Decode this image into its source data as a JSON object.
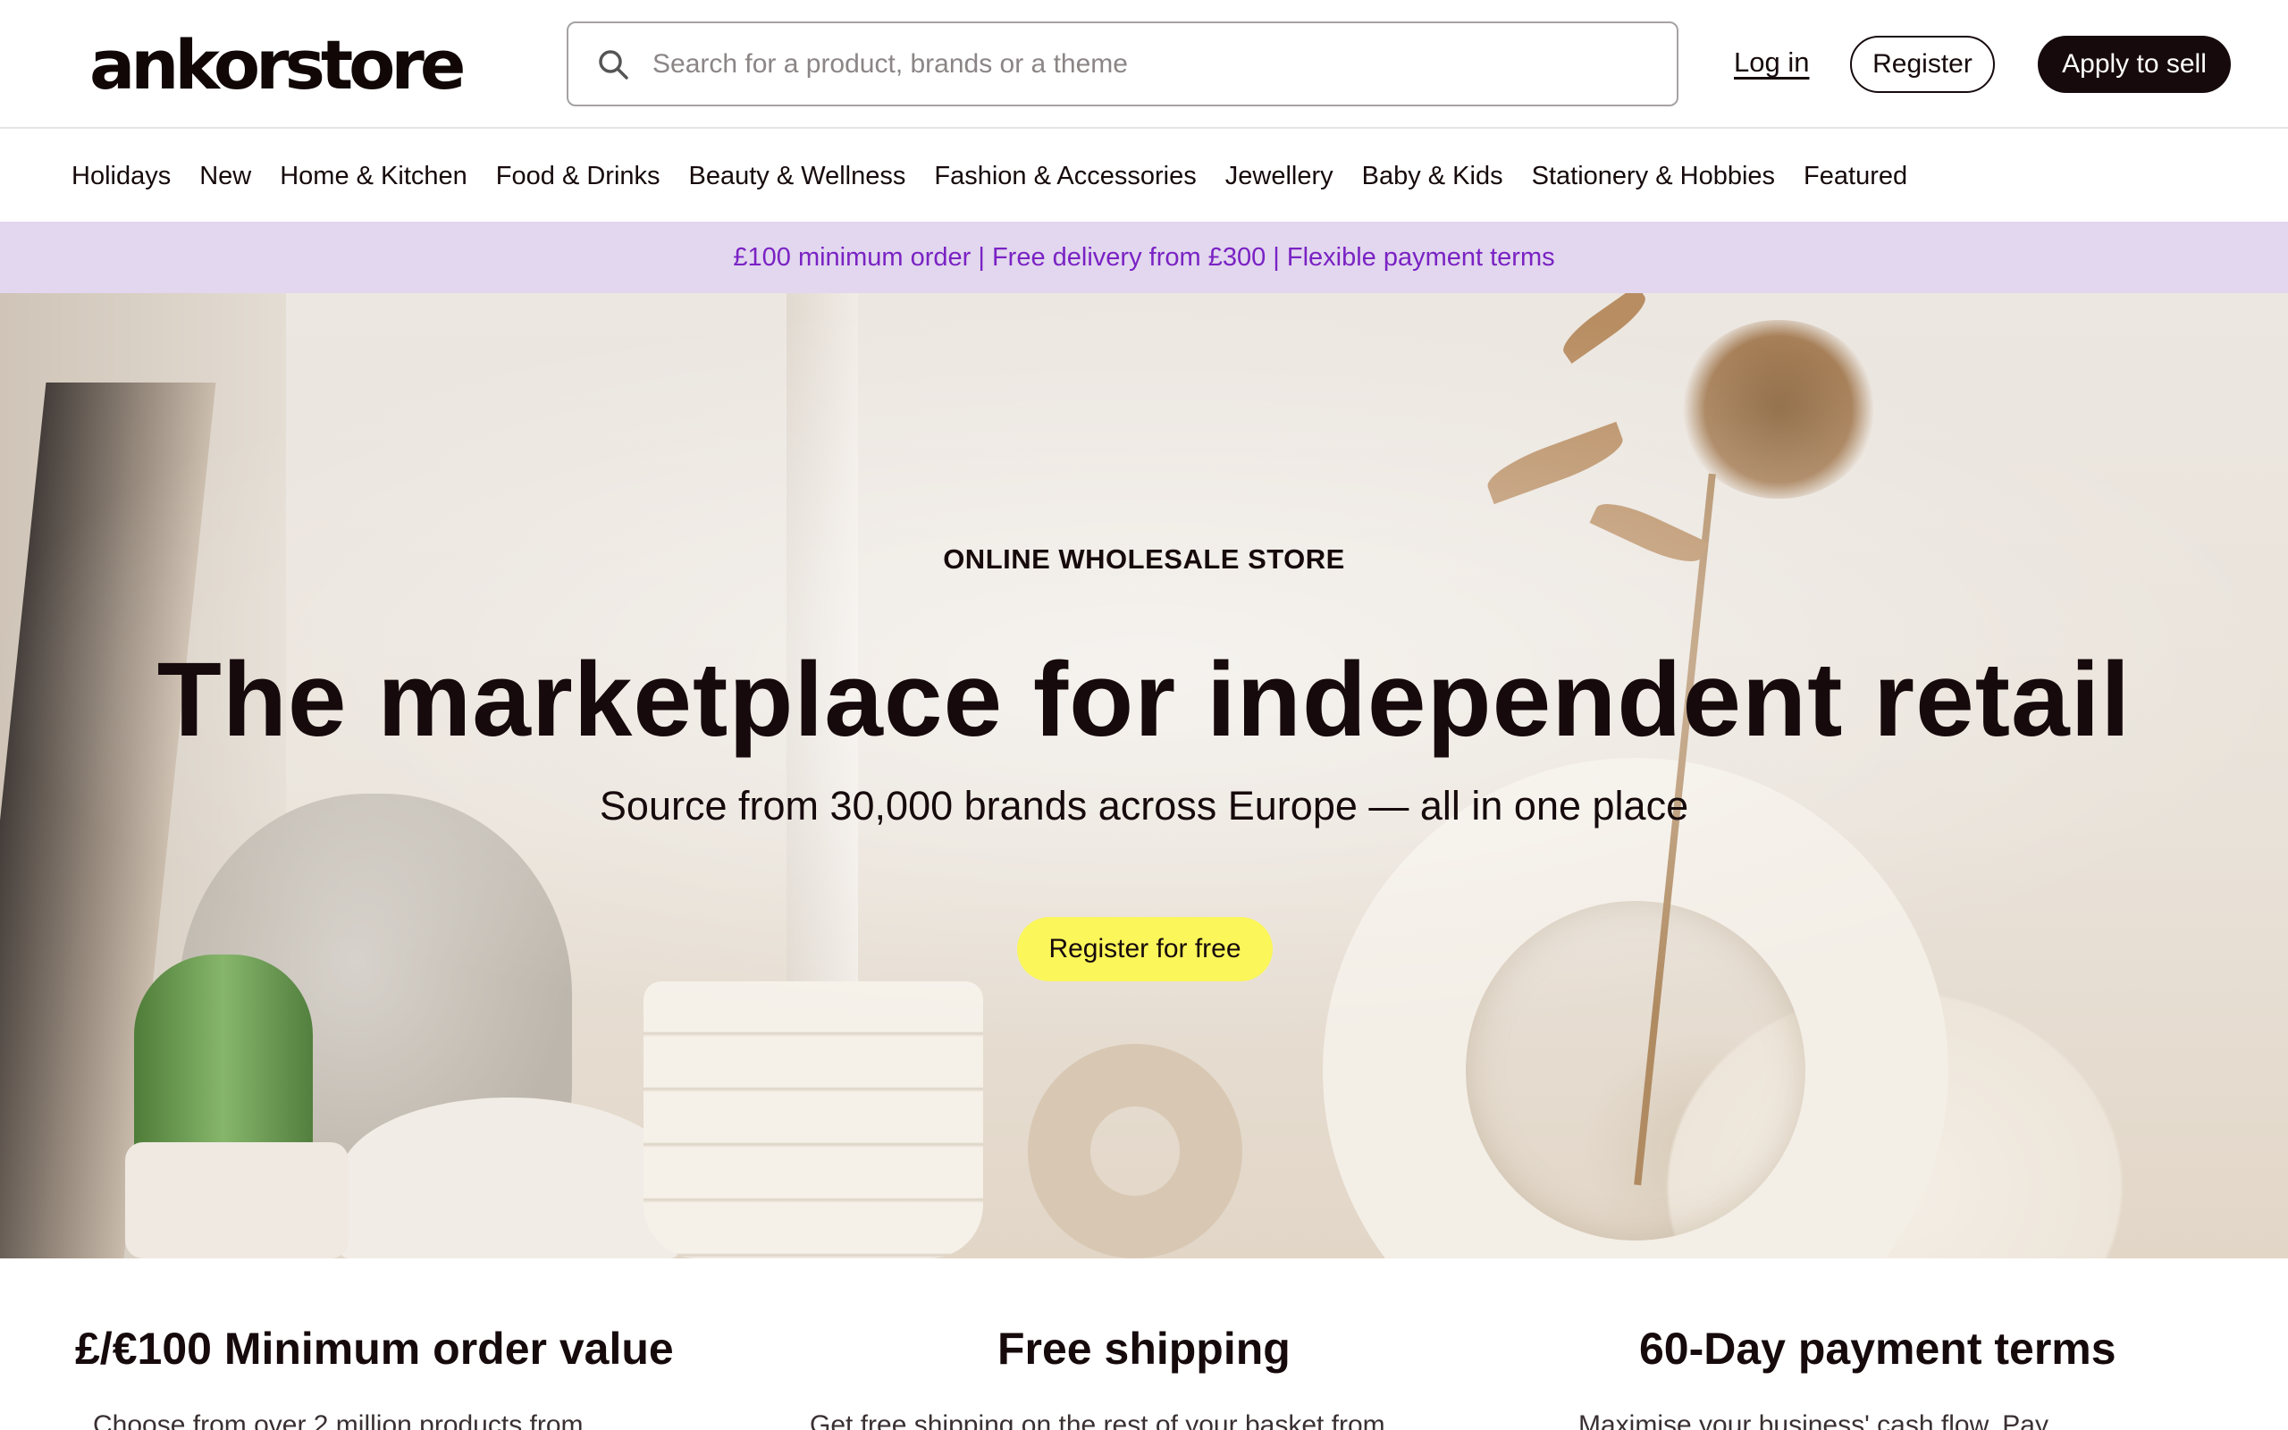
{
  "header": {
    "logo": "ankorstore",
    "search_placeholder": "Search for a product, brands or a theme",
    "login_label": "Log in",
    "register_label": "Register",
    "apply_label": "Apply to sell"
  },
  "nav": {
    "items": [
      "Holidays",
      "New",
      "Home & Kitchen",
      "Food & Drinks",
      "Beauty & Wellness",
      "Fashion & Accessories",
      "Jewellery",
      "Baby & Kids",
      "Stationery & Hobbies",
      "Featured"
    ]
  },
  "promo": {
    "text": "£100 minimum order | Free delivery from £300 | Flexible payment terms"
  },
  "hero": {
    "kicker": "ONLINE WHOLESALE STORE",
    "title": "The marketplace for independent retail",
    "subtitle": "Source from 30,000 brands across Europe — all in one place",
    "cta_label": "Register for free"
  },
  "value_props": [
    {
      "title": "£/€100 Minimum order value",
      "desc": "Choose from over 2 million products from"
    },
    {
      "title": "Free shipping",
      "desc": "Get free shipping on the rest of your basket from"
    },
    {
      "title": "60-Day payment terms",
      "desc": "Maximise your business' cash flow. Pay"
    }
  ],
  "colors": {
    "brand_dark": "#160a0c",
    "promo_bg": "#e2d7ee",
    "promo_text": "#7a22c4",
    "cta_yellow": "#fbf65a"
  }
}
